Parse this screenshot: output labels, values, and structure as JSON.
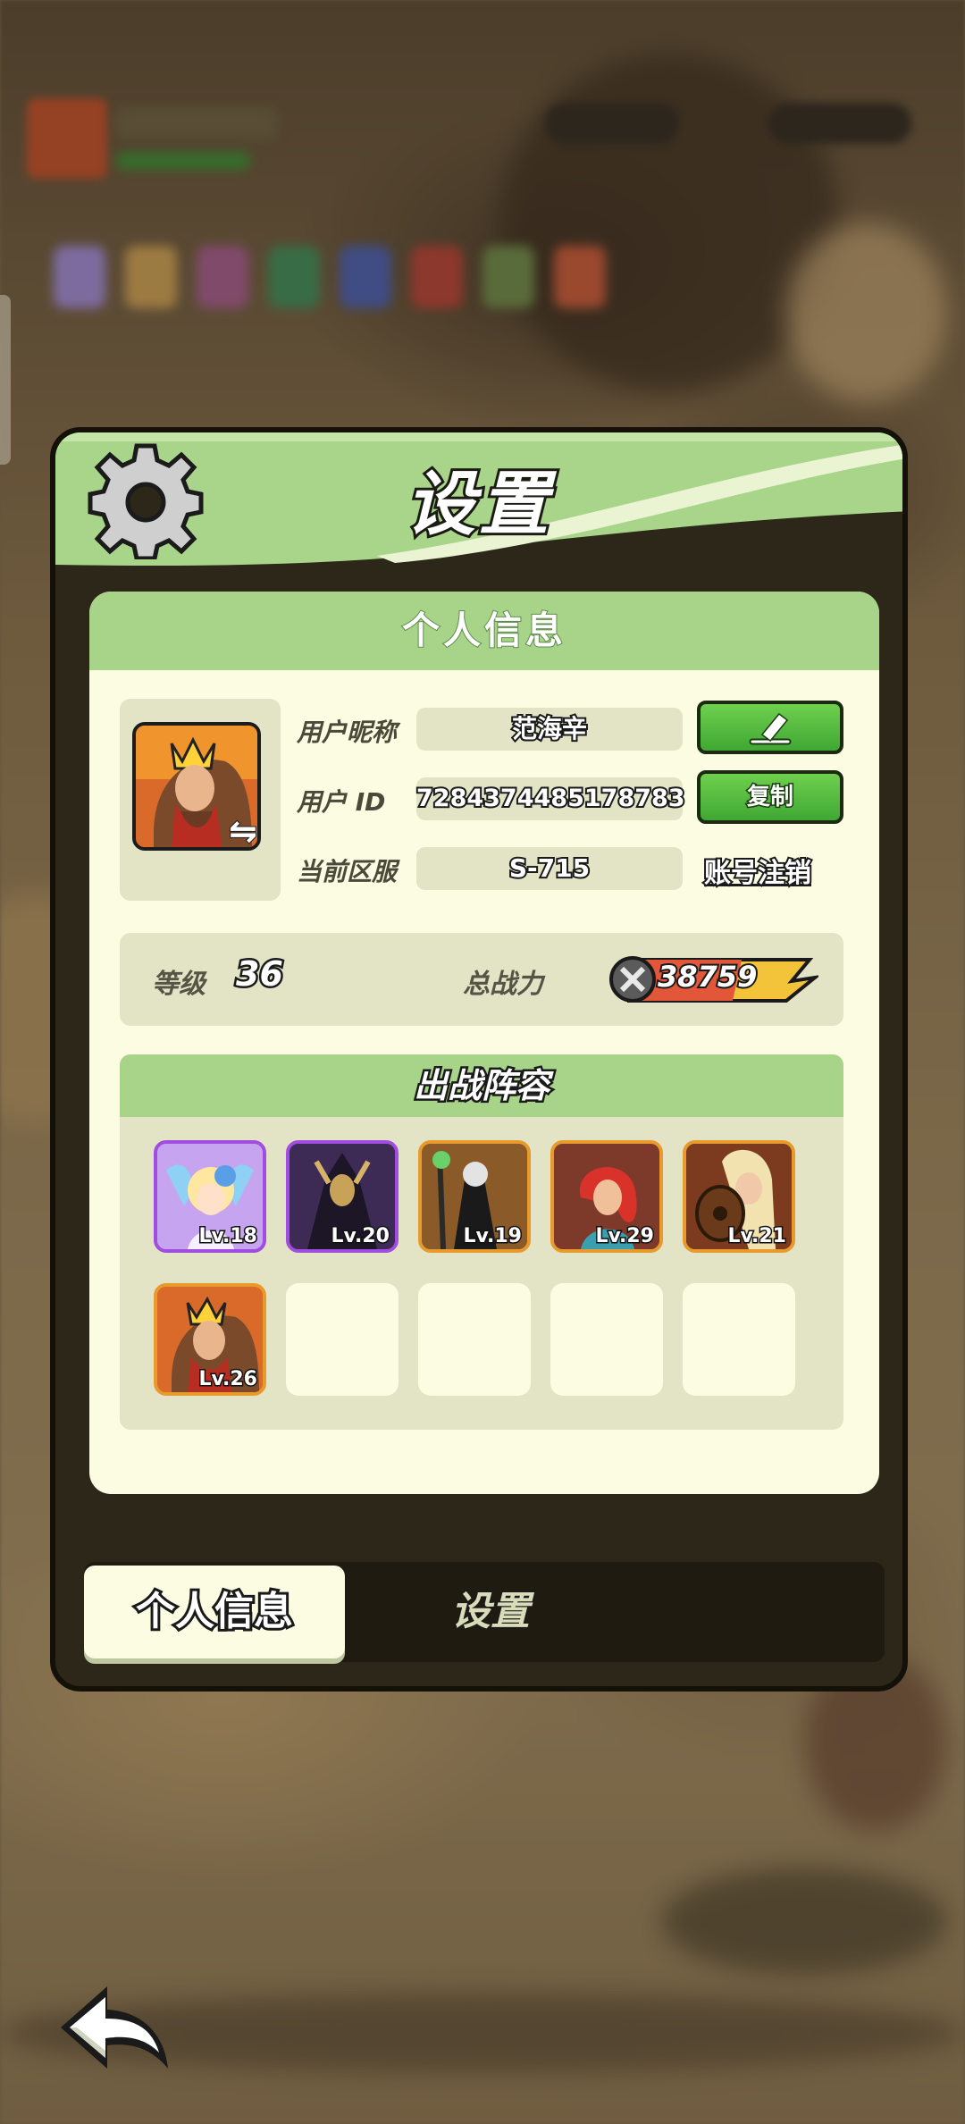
{
  "dialog": {
    "title": "设置"
  },
  "profile": {
    "section_title": "个人信息",
    "nickname_label": "用户昵称",
    "nickname": "范海辛",
    "edit_icon": "pencil-icon",
    "id_label": "用户 ID",
    "user_id": "7284374485178783",
    "copy_label": "复制",
    "server_label": "当前区服",
    "server": "S-715",
    "logout_label": "账号注销"
  },
  "stats": {
    "level_label": "等级",
    "level": "36",
    "power_label": "总战力",
    "power": "38759"
  },
  "lineup": {
    "title": "出战阵容",
    "heroes": [
      {
        "level": "Lv.18",
        "rarity": "purple"
      },
      {
        "level": "Lv.20",
        "rarity": "purple"
      },
      {
        "level": "Lv.19",
        "rarity": "orange"
      },
      {
        "level": "Lv.29",
        "rarity": "orange"
      },
      {
        "level": "Lv.21",
        "rarity": "orange"
      },
      {
        "level": "Lv.26",
        "rarity": "orange"
      }
    ]
  },
  "tabs": {
    "profile": "个人信息",
    "settings": "设置"
  },
  "colors": {
    "header_green": "#a7d488",
    "button_green": "#4fbb3c",
    "panel_dark": "#2c2719",
    "card_bg": "#fbfce2"
  }
}
